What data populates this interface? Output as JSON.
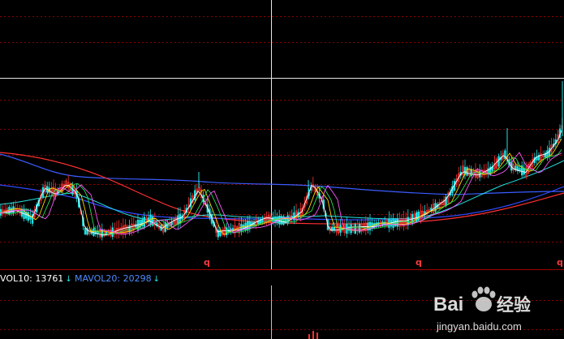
{
  "colors": {
    "background": "#000000",
    "grid_dotted": "#8b0000",
    "axis_solid": "#a00000",
    "crosshair": "#e6e6e6",
    "ma_long_blue": "#3b5cff",
    "ma_red": "#ff3030",
    "ma_cyan": "#22e0e0",
    "ma_green": "#22dd55",
    "ma_yellow": "#ffd400",
    "ma_white": "#ffffff",
    "ma_magenta": "#ff55ff",
    "candle_up": "#ff3030",
    "candle_down": "#22e0e0",
    "vol10_text": "#ffffff",
    "mavol20_text": "#4f8bff",
    "marker_text": "#ff3b3b"
  },
  "volume_panel": {
    "vol10_label": "VOL10: 13761",
    "vol10_arrow": "↓",
    "mavol20_label": "MAVOL20: 20298",
    "mavol20_arrow": "↓"
  },
  "markers": [
    "q",
    "q",
    "q"
  ],
  "watermark": {
    "brand": "Bai",
    "brand_suffix": "经验",
    "url": "jingyan.baidu.com",
    "icon": "paw-icon"
  }
}
